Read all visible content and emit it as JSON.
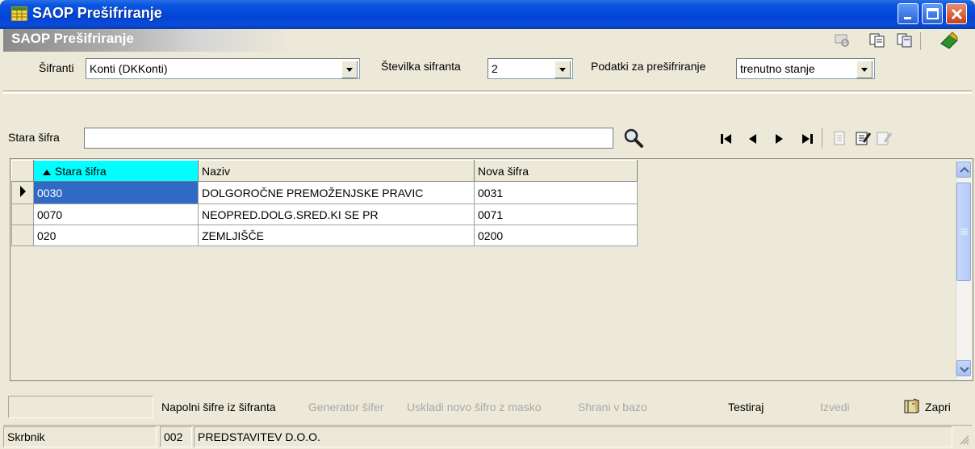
{
  "window": {
    "title": "SAOP Prešifriranje",
    "header_title": "SAOP Prešifriranje"
  },
  "filters": {
    "sifranti_label": "Šifranti",
    "sifranti_value": "Konti  (DKKonti)",
    "stevilka_label": "Številka sifranta",
    "stevilka_value": "2",
    "podatki_label": "Podatki za prešifriranje",
    "podatki_value": "trenutno stanje"
  },
  "search": {
    "label": "Stara šifra",
    "value": ""
  },
  "grid": {
    "columns": [
      "Stara šifra",
      "Naziv",
      "Nova šifra"
    ],
    "rows": [
      [
        "0030",
        "DOLGOROČNE PREMOŽENJSKE PRAVIC",
        "0031"
      ],
      [
        "0070",
        "NEOPRED.DOLG.SRED.KI SE PR",
        "0071"
      ],
      [
        "020",
        "ZEMLJIŠČE",
        "0200"
      ]
    ]
  },
  "actions": {
    "napolni": "Napolni šifre iz šifranta",
    "generator": "Generator šifer",
    "uskladi": "Uskladi novo šifro z masko",
    "shrani": "Shrani v bazo",
    "testiraj": "Testiraj",
    "izvedi": "Izvedi",
    "zapri": "Zapri"
  },
  "status": {
    "user": "Skrbnik",
    "code": "002",
    "company": "PREDSTAVITEV D.O.O."
  },
  "colors": {
    "titlebar": "#0a54e0",
    "selection": "#316ac5",
    "sorted_header": "#00ffff"
  }
}
